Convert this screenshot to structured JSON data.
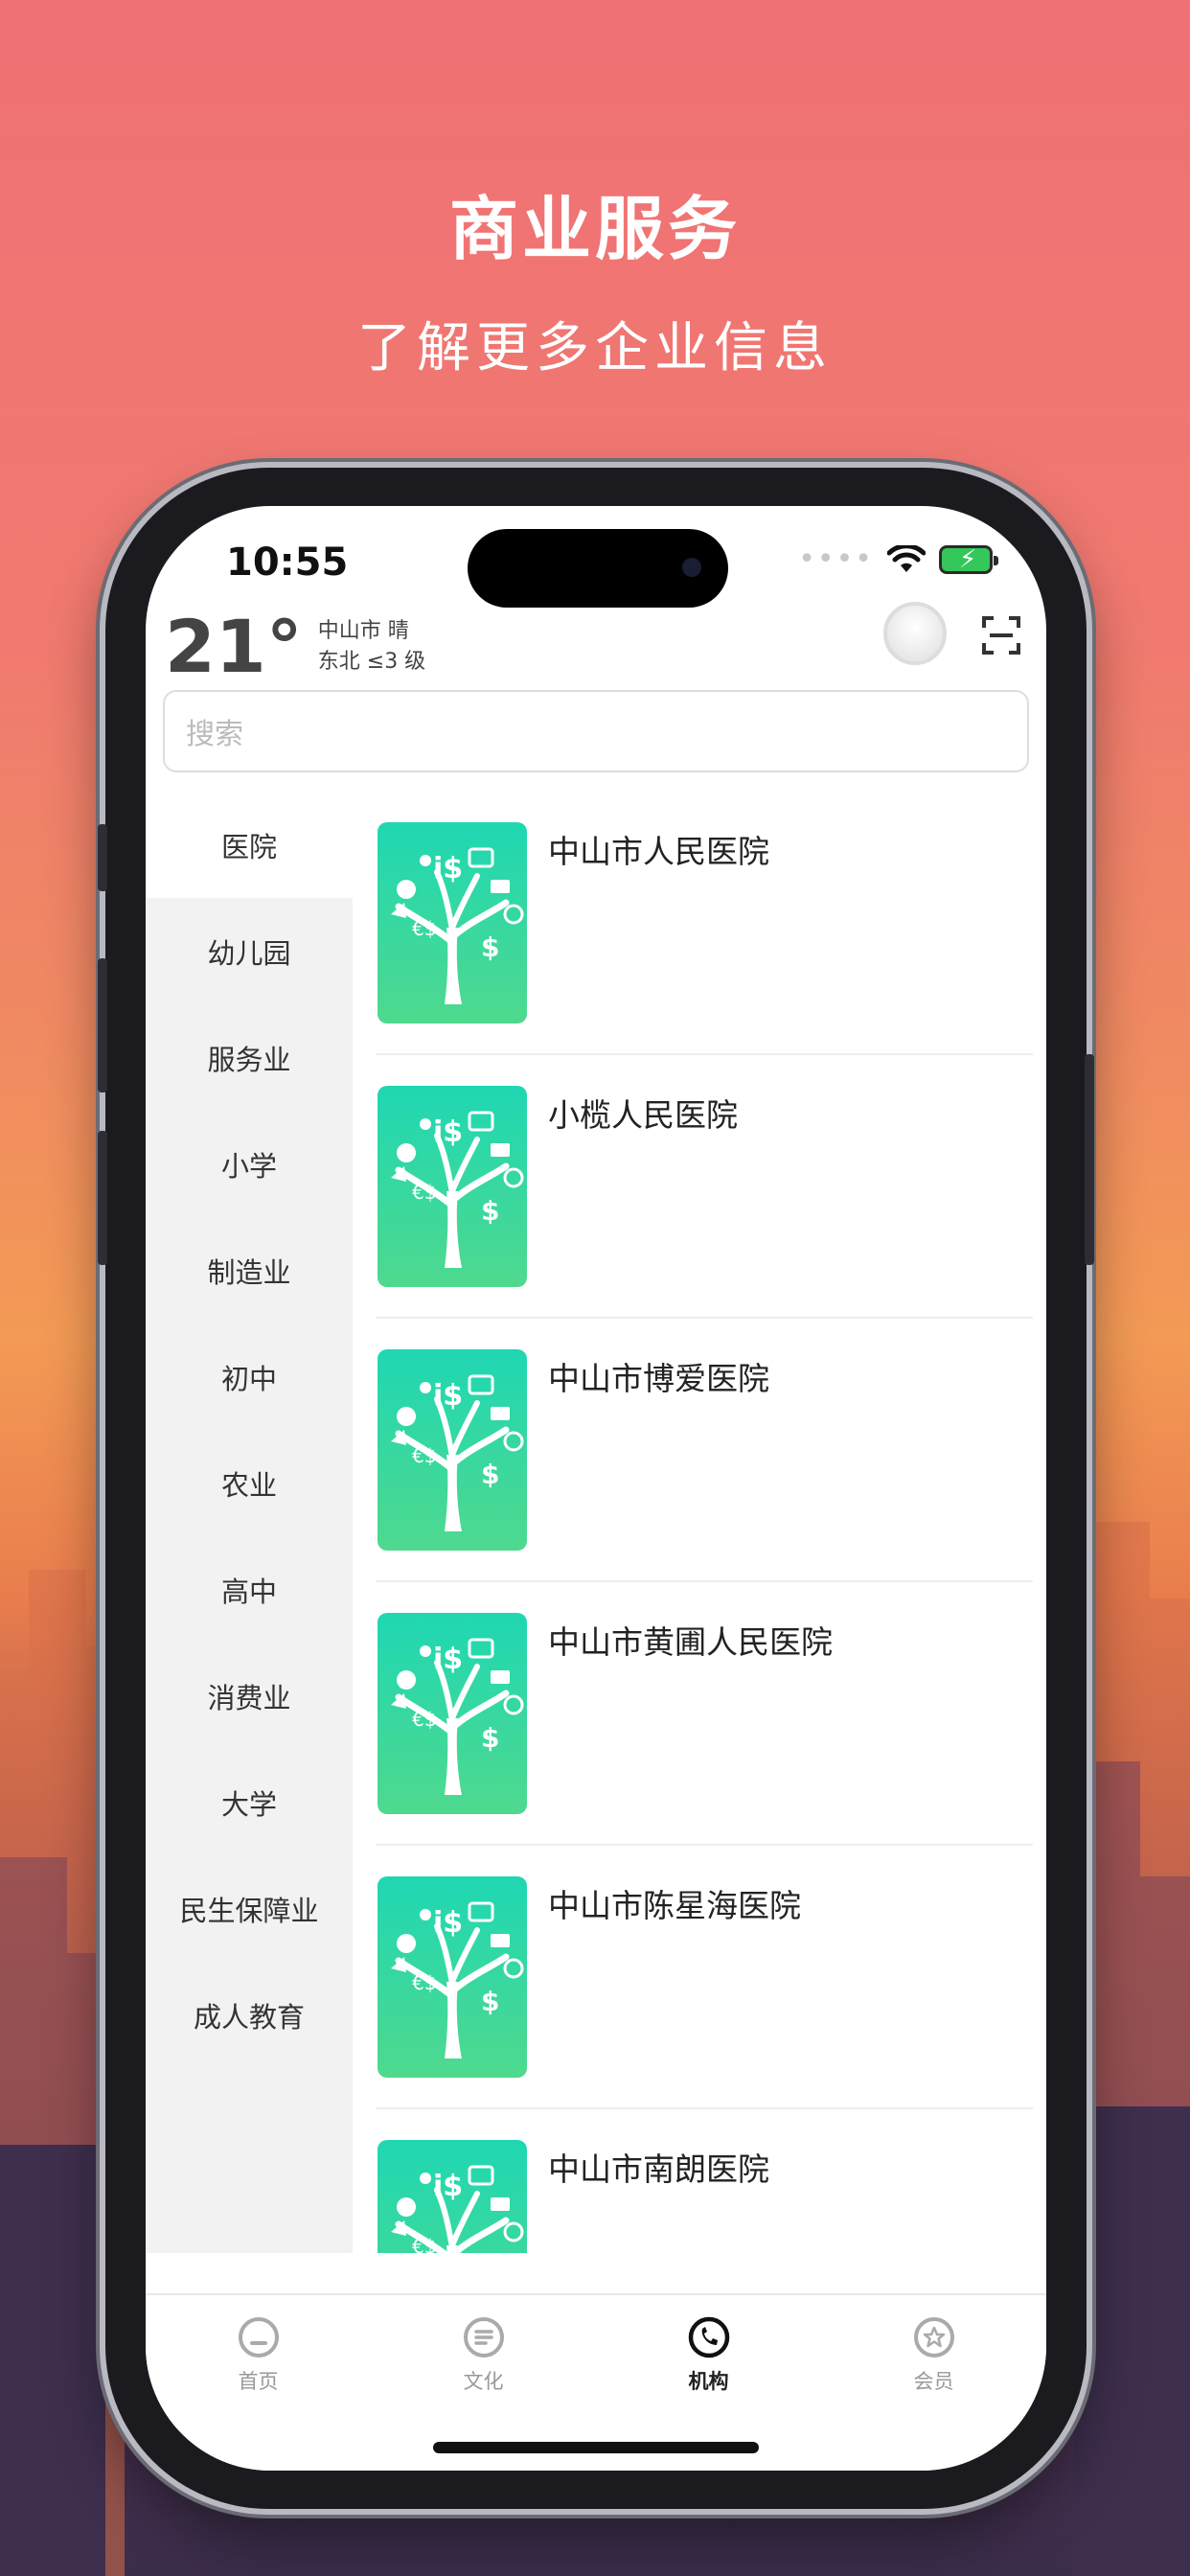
{
  "hero": {
    "title": "商业服务",
    "subtitle": "了解更多企业信息"
  },
  "status_bar": {
    "time": "10:55"
  },
  "weather": {
    "temperature": "21°",
    "city_condition": "中山市 晴",
    "wind": "东北 ≤3 级"
  },
  "search": {
    "placeholder": "搜索"
  },
  "sidebar": {
    "items": [
      {
        "label": "医院",
        "active": true
      },
      {
        "label": "幼儿园"
      },
      {
        "label": "服务业"
      },
      {
        "label": "小学"
      },
      {
        "label": "制造业"
      },
      {
        "label": "初中"
      },
      {
        "label": "农业"
      },
      {
        "label": "高中"
      },
      {
        "label": "消费业"
      },
      {
        "label": "大学"
      },
      {
        "label": "民生保障业"
      },
      {
        "label": "成人教育"
      }
    ]
  },
  "list": {
    "items": [
      {
        "title": "中山市人民医院"
      },
      {
        "title": "小榄人民医院"
      },
      {
        "title": "中山市博爱医院"
      },
      {
        "title": "中山市黄圃人民医院"
      },
      {
        "title": "中山市陈星海医院"
      },
      {
        "title": "中山市南朗医院"
      }
    ]
  },
  "tabbar": {
    "items": [
      {
        "label": "首页",
        "icon": "home-icon"
      },
      {
        "label": "文化",
        "icon": "list-icon"
      },
      {
        "label": "机构",
        "icon": "phone-icon",
        "active": true
      },
      {
        "label": "会员",
        "icon": "star-icon"
      }
    ]
  },
  "colors": {
    "accent_green": "#34c759",
    "thumb_gradient_top": "#1fd7b3",
    "thumb_gradient_bottom": "#4fd98e"
  }
}
